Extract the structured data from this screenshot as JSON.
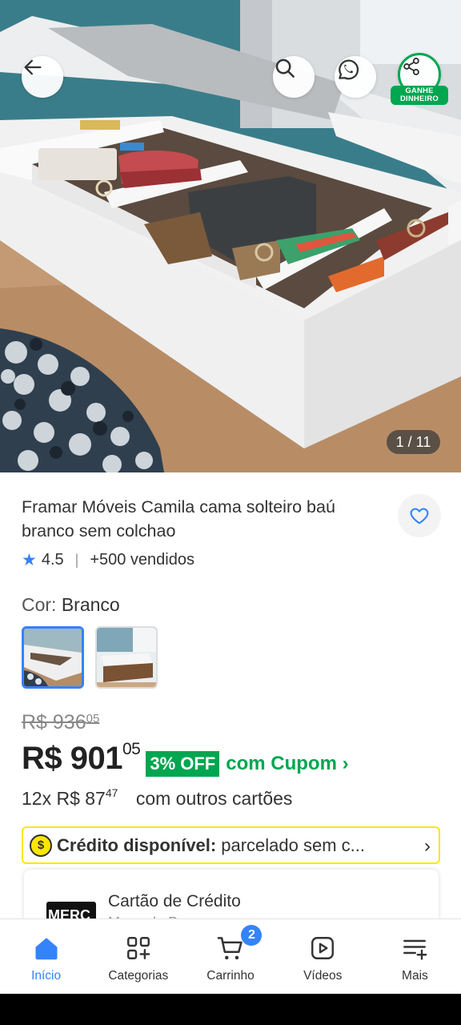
{
  "hero": {
    "counter": "1 / 11",
    "share_badge_line1": "GANHE",
    "share_badge_line2": "DINHEIRO"
  },
  "product": {
    "title": "Framar Móveis Camila cama solteiro baú branco sem colchao",
    "rating": "4.5",
    "sold": "+500 vendidos",
    "color_label": "Cor:",
    "color_value": "Branco",
    "old_price_main": "R$ 936",
    "old_price_cents": "05",
    "price_main": "R$ 901",
    "price_cents": "05",
    "off_badge": "3% OFF",
    "coupon_text": "com Cupom",
    "installments_main": "12x R$ 87",
    "installments_cents": "47",
    "installments_note": "com outros cartões",
    "credit_bold": "Crédito disponível:",
    "credit_text": "parcelado sem c...",
    "card_title": "Cartão de Crédito",
    "card_sub": "Mercado Pago",
    "card_logo_text": "MERC"
  },
  "nav": {
    "items": [
      {
        "label": "Início",
        "icon": "home-icon"
      },
      {
        "label": "Categorias",
        "icon": "categories-icon"
      },
      {
        "label": "Carrinho",
        "icon": "cart-icon"
      },
      {
        "label": "Vídeos",
        "icon": "video-icon"
      },
      {
        "label": "Mais",
        "icon": "menu-plus-icon"
      }
    ],
    "cart_count": "2"
  },
  "colors": {
    "accent_blue": "#3483fa",
    "green": "#00a650",
    "yellow": "#ffe600"
  }
}
